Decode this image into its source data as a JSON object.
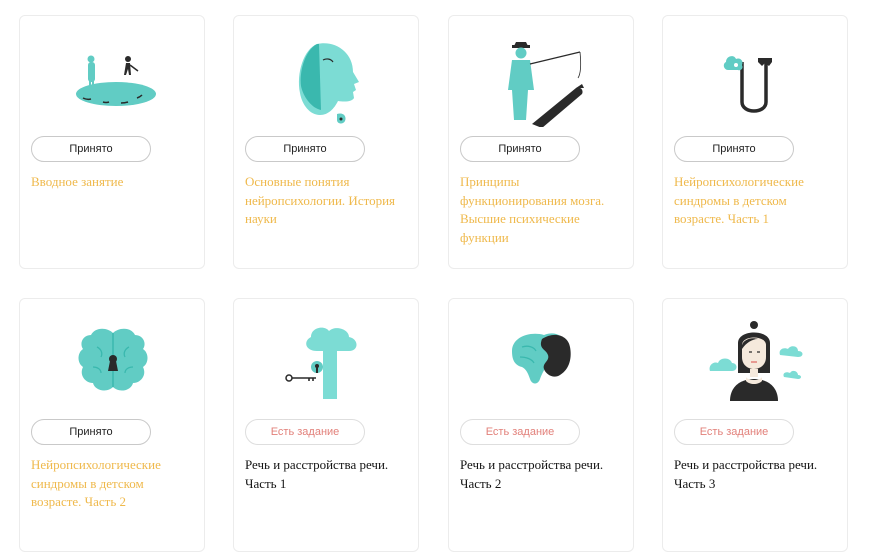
{
  "colors": {
    "teal": "#61ccc4",
    "teal_dark": "#3ab8ae",
    "dark": "#2a2a2a",
    "done_title": "#efb94c",
    "task_badge_text": "#e2807a"
  },
  "cards": [
    {
      "icon": "golf-island-icon",
      "status": "Принято",
      "status_type": "done",
      "title": "Вводное занятие"
    },
    {
      "icon": "head-profile-icon",
      "status": "Принято",
      "status_type": "done",
      "title": "Основные понятия нейропсихологии. История науки"
    },
    {
      "icon": "fisherman-icon",
      "status": "Принято",
      "status_type": "done",
      "title": "Принципы функционирования мозга. Высшие психические функции"
    },
    {
      "icon": "magnet-cloud-icon",
      "status": "Принято",
      "status_type": "done",
      "title": "Нейропсихологические синдромы в детском возрасте. Часть 1"
    },
    {
      "icon": "brain-keyhole-icon",
      "status": "Принято",
      "status_type": "done",
      "title": "Нейропсихологические синдромы в детском возрасте. Часть 2"
    },
    {
      "icon": "tree-key-icon",
      "status": "Есть задание",
      "status_type": "task",
      "title": "Речь и расстройства речи. Часть 1"
    },
    {
      "icon": "brain-side-icon",
      "status": "Есть задание",
      "status_type": "task",
      "title": "Речь и расстройства речи. Часть 2"
    },
    {
      "icon": "woman-clouds-icon",
      "status": "Есть задание",
      "status_type": "task",
      "title": "Речь и расстройства речи. Часть 3"
    }
  ]
}
